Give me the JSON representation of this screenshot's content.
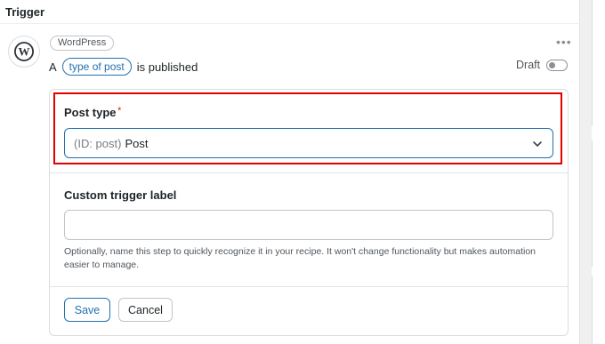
{
  "section": {
    "title": "Trigger"
  },
  "trigger": {
    "integration": "WordPress",
    "sentence": {
      "prefix": "A",
      "token": "type of post",
      "suffix": "is published"
    },
    "status_label": "Draft",
    "status_on": false
  },
  "form": {
    "post_type": {
      "label": "Post type",
      "required_mark": "*",
      "value_meta": "(ID: post)",
      "value": "Post"
    },
    "custom_label": {
      "label": "Custom trigger label",
      "value": "",
      "placeholder": "",
      "help": "Optionally, name this step to quickly recognize it in your recipe. It won't change functionality but makes automation easier to manage."
    },
    "buttons": {
      "save": "Save",
      "cancel": "Cancel"
    }
  },
  "colors": {
    "accent": "#2271b1",
    "highlight": "#e00000",
    "required": "#d63638"
  },
  "icons": [
    "wordpress-logo-icon",
    "more-options-icon",
    "chevron-down-icon"
  ]
}
